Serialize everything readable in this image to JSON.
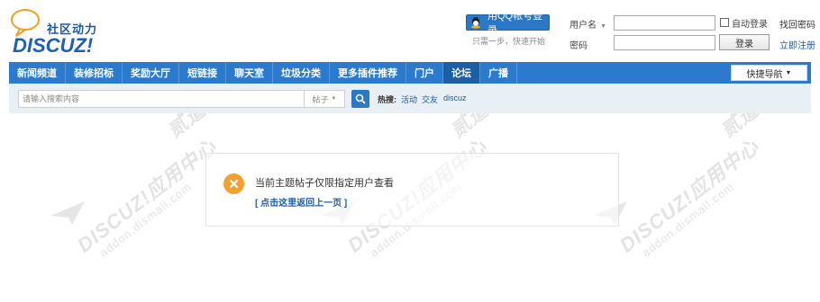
{
  "logo": {
    "cn": "社区动力",
    "en": "DISCUZ!"
  },
  "login": {
    "qq_button": "用QQ帐号登录",
    "qq_hint": "只需一步，快速开始",
    "username_label": "用户名",
    "password_label": "密码",
    "auto_login": "自动登录",
    "login_button": "登录",
    "forgot_password": "找回密码",
    "register": "立即注册"
  },
  "nav": {
    "items": [
      "新闻频道",
      "装修招标",
      "奖励大厅",
      "短链接",
      "聊天室",
      "垃圾分类",
      "更多插件推荐",
      "门户",
      "论坛",
      "广播"
    ],
    "active_index": 8,
    "quick_nav": "快捷导航"
  },
  "search": {
    "placeholder": "请输入搜索内容",
    "type": "帖子",
    "hot_label": "热搜:",
    "hot_links": [
      "活动",
      "交友",
      "discuz"
    ]
  },
  "watermark": {
    "line1": "DISCUZ!应用中心",
    "line2": "addon.dismall.com",
    "line3": "贰道"
  },
  "message": {
    "text": "当前主题帖子仅限指定用户查看",
    "back_link": "[ 点击这里返回上一页 ]"
  },
  "colors": {
    "nav_blue": "#2b7acd",
    "nav_active": "#1d5fa5",
    "warning_orange": "#f2a02f",
    "link_blue": "#1d5ca6"
  }
}
